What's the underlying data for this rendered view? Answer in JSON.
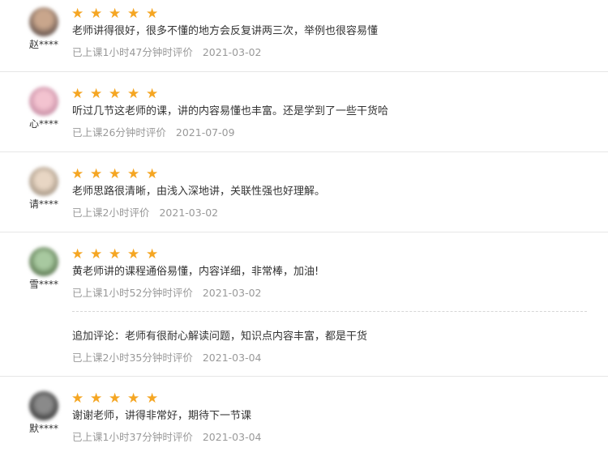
{
  "colors": {
    "star": "#f5a623",
    "meta": "#999999",
    "text": "#333333",
    "divider": "#e6e6e6"
  },
  "reviews": [
    {
      "user": "赵****",
      "rating": 5,
      "comment": "老师讲得很好，很多不懂的地方会反复讲两三次，举例也很容易懂",
      "time": "已上课1小时47分钟时评价",
      "date": "2021-03-02"
    },
    {
      "user": "心****",
      "rating": 5,
      "comment": "听过几节这老师的课，讲的内容易懂也丰富。还是学到了一些干货哈",
      "time": "已上课26分钟时评价",
      "date": "2021-07-09"
    },
    {
      "user": "请****",
      "rating": 5,
      "comment": "老师思路很清晰，由浅入深地讲，关联性强也好理解。",
      "time": "已上课2小时评价",
      "date": "2021-03-02"
    },
    {
      "user": "雪****",
      "rating": 5,
      "comment": "黄老师讲的课程通俗易懂，内容详细，非常棒，加油!",
      "time": "已上课1小时52分钟时评价",
      "date": "2021-03-02",
      "followup": {
        "comment": "追加评论：老师有很耐心解读问题，知识点内容丰富，都是干货",
        "time": "已上课2小时35分钟时评价",
        "date": "2021-03-04"
      }
    },
    {
      "user": "默****",
      "rating": 5,
      "comment": "谢谢老师，讲得非常好，期待下一节课",
      "time": "已上课1小时37分钟时评价",
      "date": "2021-03-04"
    }
  ]
}
